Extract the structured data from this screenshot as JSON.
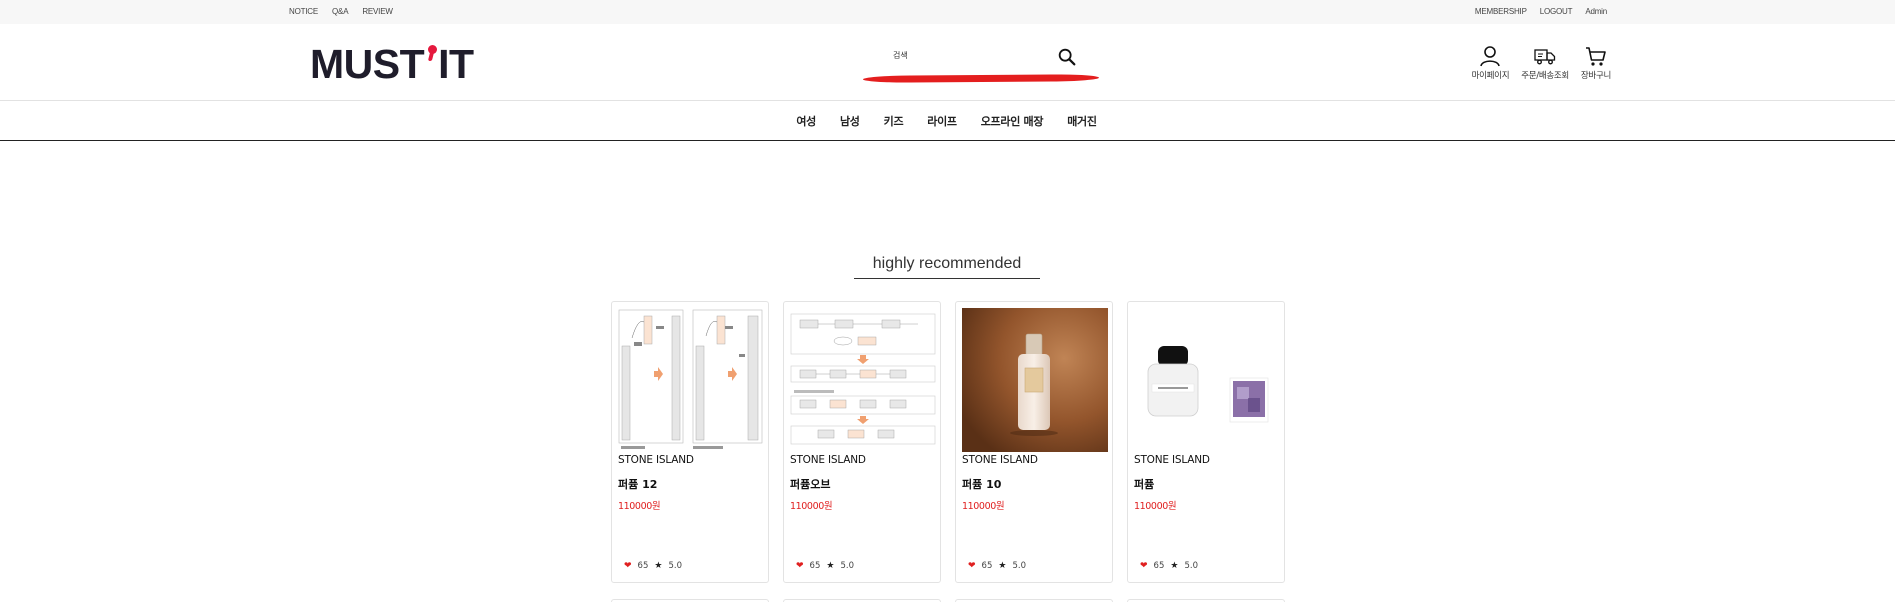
{
  "topbar": {
    "left": [
      "NOTICE",
      "Q&A",
      "REVIEW"
    ],
    "right": [
      "MEMBERSHIP",
      "LOGOUT",
      "Admin"
    ]
  },
  "header": {
    "logo_left": "MUST",
    "logo_right": "IT",
    "search_value": "검색",
    "icons": [
      {
        "label": "마이페이지",
        "icon": "user-icon"
      },
      {
        "label": "주문/배송조회",
        "icon": "truck-icon"
      },
      {
        "label": "장바구니",
        "icon": "cart-icon"
      }
    ]
  },
  "nav": {
    "items": [
      "여성",
      "남성",
      "키즈",
      "라이프",
      "오프라인 매장",
      "매거진"
    ]
  },
  "section": {
    "title": "highly recommended"
  },
  "products": [
    {
      "brand": "STONE ISLAND",
      "name": "퍼퓸 12",
      "price": "110000원",
      "likes": "65",
      "rating": "5.0"
    },
    {
      "brand": "STONE ISLAND",
      "name": "퍼퓸오브",
      "price": "110000원",
      "likes": "65",
      "rating": "5.0"
    },
    {
      "brand": "STONE ISLAND",
      "name": "퍼퓸 10",
      "price": "110000원",
      "likes": "65",
      "rating": "5.0"
    },
    {
      "brand": "STONE ISLAND",
      "name": "퍼퓸",
      "price": "110000원",
      "likes": "65",
      "rating": "5.0"
    }
  ],
  "colors": {
    "accent": "#e5193e",
    "price": "#e02020",
    "logo": "#1f1d2b"
  }
}
